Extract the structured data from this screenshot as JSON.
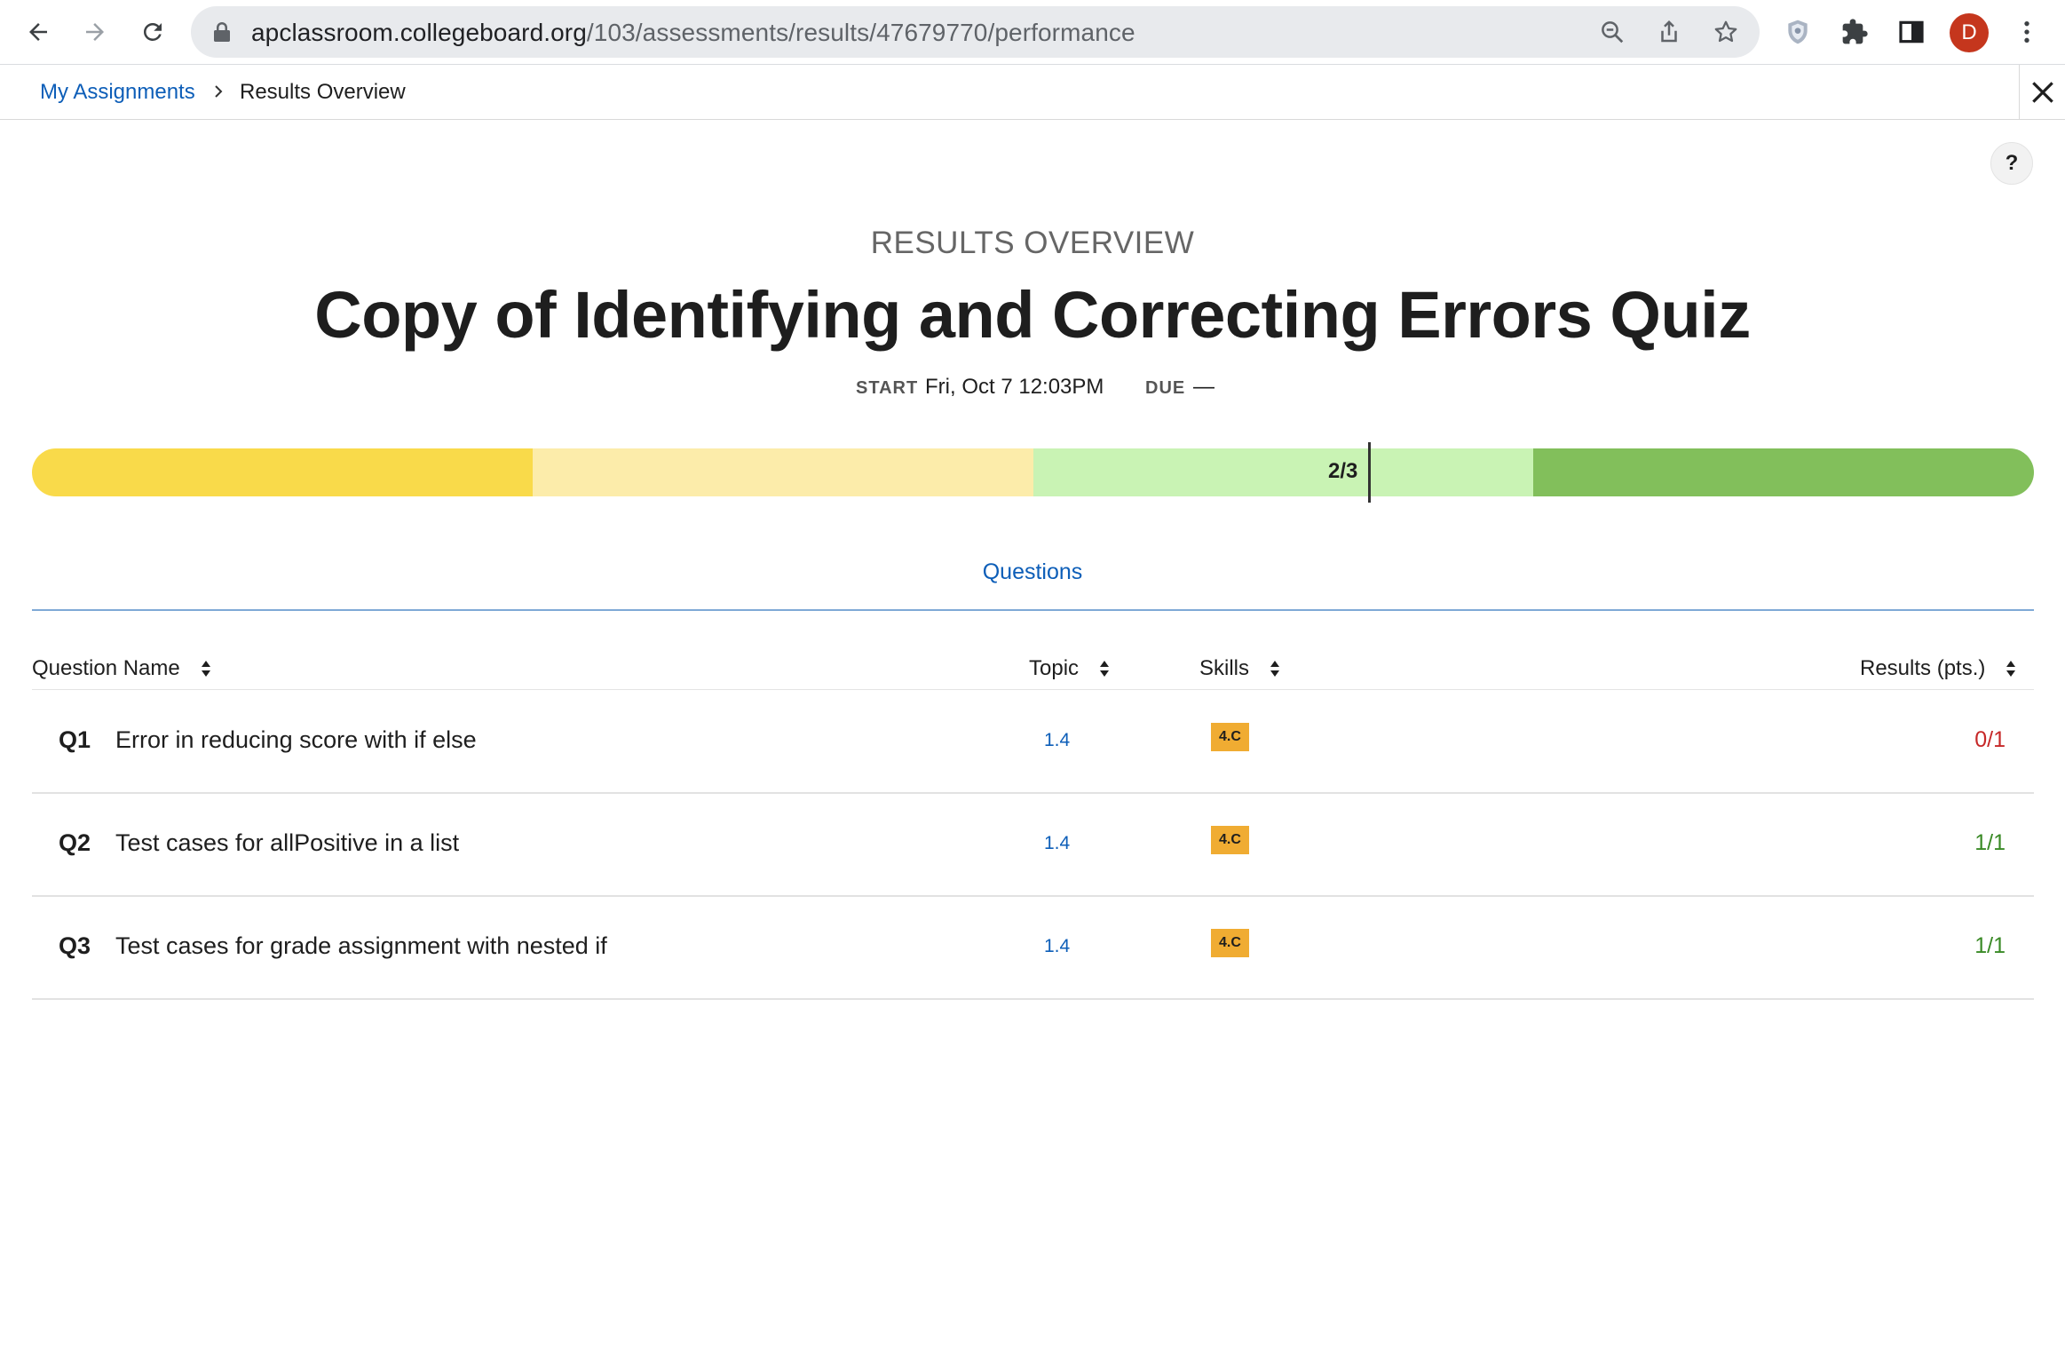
{
  "browser": {
    "url_host": "apclassroom.collegeboard.org",
    "url_path": "/103/assessments/results/47679770/performance",
    "profile_initial": "D",
    "icons": [
      "back-icon",
      "forward-icon",
      "reload-icon",
      "lock-icon",
      "zoom-out-icon",
      "share-icon",
      "bookmark-star-icon",
      "shield-extension-icon",
      "extensions-puzzle-icon",
      "side-panel-icon",
      "more-vert-icon"
    ]
  },
  "appbar": {
    "breadcrumb_link": "My Assignments",
    "breadcrumb_current": "Results Overview"
  },
  "help_label": "?",
  "header": {
    "eyebrow": "RESULTS OVERVIEW",
    "title": "Copy of Identifying and Correcting Errors Quiz",
    "start_label": "START",
    "start_value": "Fri, Oct 7 12:03PM",
    "due_label": "DUE",
    "due_value": "—"
  },
  "progress": {
    "score_label": "2/3",
    "score_fraction": 0.667,
    "segment_colors": [
      "#f9da4a",
      "#fcecaa",
      "#c9f3b4",
      "#82bf5b"
    ]
  },
  "tabs": [
    "Questions"
  ],
  "table": {
    "columns": [
      "Question Name",
      "Topic",
      "Skills",
      "Results (pts.)"
    ],
    "rows": [
      {
        "num": "Q1",
        "name": "Error in reducing score with if else",
        "topic": "1.4",
        "skill": "4.C",
        "result": "0/1",
        "status": "incorrect"
      },
      {
        "num": "Q2",
        "name": "Test cases for allPositive in a list",
        "topic": "1.4",
        "skill": "4.C",
        "result": "1/1",
        "status": "correct"
      },
      {
        "num": "Q3",
        "name": "Test cases for grade assignment with nested if",
        "topic": "1.4",
        "skill": "4.C",
        "result": "1/1",
        "status": "correct"
      }
    ]
  },
  "colors": {
    "link": "#0d5eb8",
    "incorrect": "#c62828",
    "correct": "#3a8a26",
    "skill_badge": "#f0ac32"
  }
}
